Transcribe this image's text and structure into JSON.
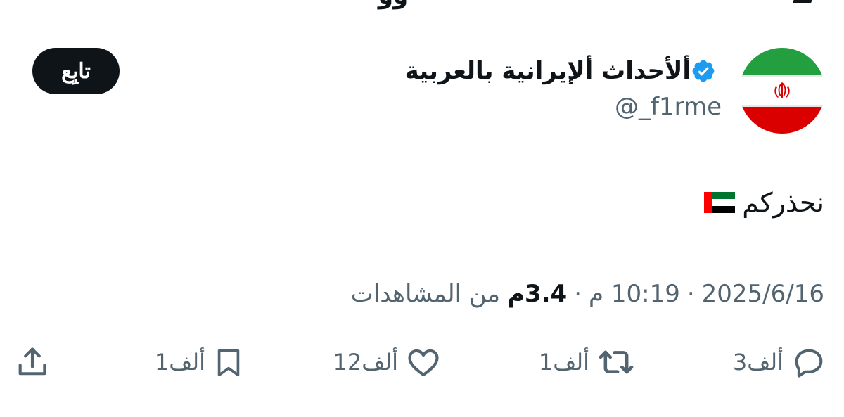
{
  "previous_post": {
    "cut_text": "وو"
  },
  "author": {
    "display_name": "ألأحداث ألإيرانية بالعربية",
    "handle": "@_f1rme",
    "avatar_icon": "iran-flag-avatar",
    "verified_icon": "verified-badge-icon",
    "verified_color": "#1d9bf0"
  },
  "follow_button": {
    "label": "تابِع"
  },
  "tweet": {
    "text": "نحذركم",
    "emoji_icon": "uae-flag-emoji"
  },
  "meta": {
    "time": "10:19 م",
    "date": "2025/6/16",
    "views_count": "3.4م",
    "views_label": "من المشاهدات",
    "separator": "·"
  },
  "actions": {
    "reply": {
      "count": "3ألف",
      "icon": "reply-icon"
    },
    "retweet": {
      "count": "1ألف",
      "icon": "retweet-icon"
    },
    "like": {
      "count": "12ألف",
      "icon": "heart-icon"
    },
    "bookmark": {
      "count": "1ألف",
      "icon": "bookmark-icon"
    },
    "share": {
      "icon": "share-icon"
    }
  },
  "colors": {
    "text_primary": "#0f1419",
    "text_secondary": "#536471",
    "button_bg": "#0f1419"
  }
}
